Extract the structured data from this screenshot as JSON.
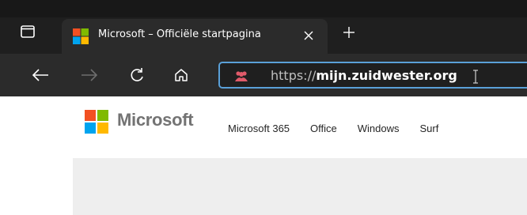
{
  "browser": {
    "tab": {
      "title": "Microsoft – Officiële startpagina",
      "close_symbol": "✕"
    },
    "new_tab_symbol": "+",
    "address": {
      "scheme": "https://",
      "domain": "mijn.zuidwester.org"
    },
    "icons": {
      "tab_actions": "tab-actions-icon",
      "back": "back-arrow-icon",
      "forward": "forward-arrow-icon",
      "refresh": "refresh-icon",
      "home": "home-icon",
      "site": "people-icon"
    },
    "colors": {
      "address_border": "#5aa0d8",
      "site_icon": "#e05a6a"
    }
  },
  "page": {
    "brand": "Microsoft",
    "nav": [
      "Microsoft 365",
      "Office",
      "Windows",
      "Surf"
    ]
  }
}
